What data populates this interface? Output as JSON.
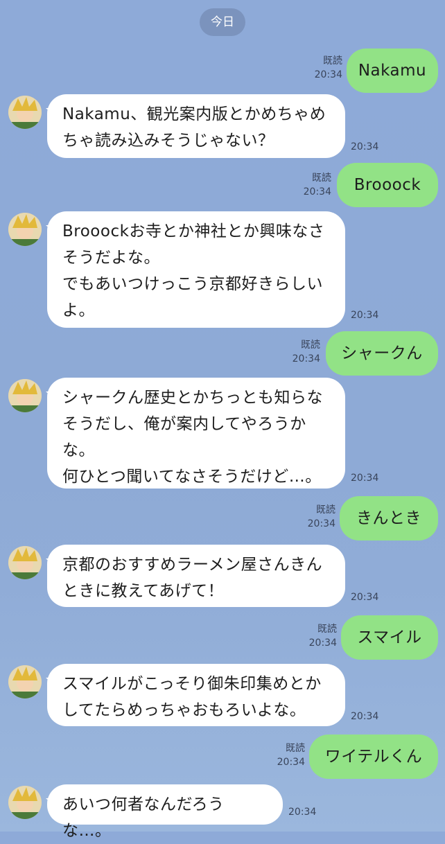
{
  "date_label": "今日",
  "read_label": "既読",
  "messages": [
    {
      "dir": "out",
      "text": "Nakamu",
      "time": "20:34"
    },
    {
      "dir": "in",
      "text": "Nakamu、観光案内版とかめちゃめ\nちゃ読み込みそうじゃない？",
      "time": "20:34"
    },
    {
      "dir": "out",
      "text": "Brooock",
      "time": "20:34"
    },
    {
      "dir": "in",
      "text": "Brooockお寺とか神社とか興味なさ\nそうだよな。\nでもあいつけっこう京都好きらしい\nよ。",
      "time": "20:34"
    },
    {
      "dir": "out",
      "text": "シャークん",
      "time": "20:34"
    },
    {
      "dir": "in",
      "text": "シャークん歴史とかちっとも知らな\nそうだし、俺が案内してやろうか\nな。\n何ひとつ聞いてなさそうだけど…。",
      "time": "20:34"
    },
    {
      "dir": "out",
      "text": "きんとき",
      "time": "20:34"
    },
    {
      "dir": "in",
      "text": "京都のおすすめラーメン屋さんきん\nときに教えてあげて！",
      "time": "20:34"
    },
    {
      "dir": "out",
      "text": "スマイル",
      "time": "20:34"
    },
    {
      "dir": "in",
      "text": "スマイルがこっそり御朱印集めとか\nしてたらめっちゃおもろいよな。",
      "time": "20:34"
    },
    {
      "dir": "out",
      "text": "ワイテルくん",
      "time": "20:34"
    },
    {
      "dir": "in",
      "text": "あいつ何者なんだろうな…。",
      "time": "20:34"
    }
  ]
}
